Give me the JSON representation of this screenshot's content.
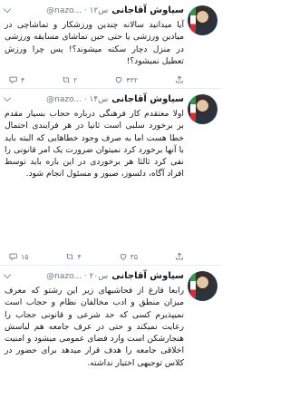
{
  "tweets": [
    {
      "author": "سیاوش آقاجانی",
      "handle_time": "@nazo... · ۱۲س",
      "text": "آیا میدانید سالانه چندین ورزشکار و تماشاچی در میادین ورزشی یا حتی حین تماشای مسابقه ورزشی در منزل دچار سکته میشوند؟! پس چرا ورزش تعطیل نمیشود؟!",
      "replies": "۴",
      "retweets": "۲",
      "likes": "۴۳۲"
    },
    {
      "author": "سیاوش آقاجانی",
      "handle_time": "@nazo... · ۱۴س",
      "text": "اولا معتقدم کار فرهنگی درباره حجاب بسیار مقدم بر برخورد سلبی است ثانیا در هر فرایندی احتمال خطا هست اما به صرف وجود خطاهایی که البته باید با آنها برخورد کرد نمیتوان ضرورت یک امر قانونی را نفی کرد ثالثا هر برخوردی در این باره باید توسط افراد آگاه، دلسوز، صبور و مسئول انجام شود.",
      "replies": "۱۵",
      "retweets": "۴",
      "likes": "۳۵"
    },
    {
      "author": "سیاوش آقاجانی",
      "handle_time": "@nazo... · ۲۰س",
      "text": "رابعا فارغ از فحاشیهای زیر این رشتو که معرف میزان منطق و ادب مخالفان نظام و حجاب است نمیپذیرم کسی که حد شرعی و قانونی حجاب را رعایت نمیکند و حتی در عرف جامعه هم لباسش هنجارشکن است وارد فضای عمومی میشود و امنیت اخلاقی جامعه را هدف قرار میدهد برای حضور در کلاس توجیهی اختیار نداشته."
    }
  ]
}
